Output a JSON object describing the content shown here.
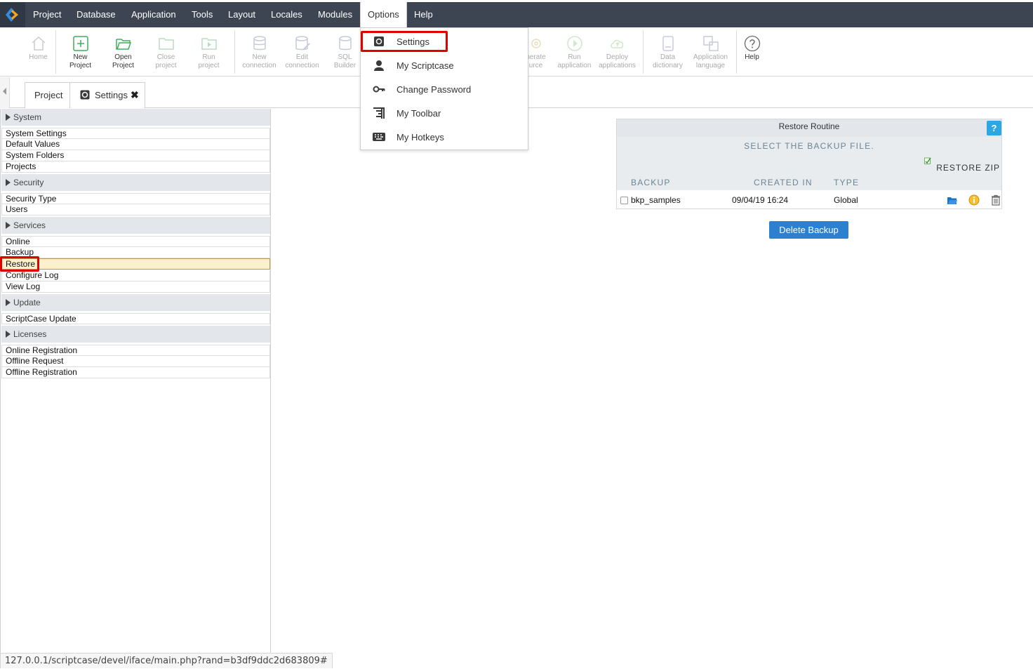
{
  "menubar": {
    "items": [
      "Project",
      "Database",
      "Application",
      "Tools",
      "Layout",
      "Locales",
      "Modules",
      "Options",
      "Help"
    ],
    "active": "Options"
  },
  "toolbar": {
    "buttons": [
      {
        "label1": "Home",
        "label2": "",
        "icon": "home-icon"
      },
      {
        "label1": "New",
        "label2": "Project",
        "icon": "plus-square-icon"
      },
      {
        "label1": "Open",
        "label2": "Project",
        "icon": "folder-open-icon"
      },
      {
        "label1": "Close",
        "label2": "project",
        "icon": "folder-icon"
      },
      {
        "label1": "Run",
        "label2": "project",
        "icon": "play-folder-icon"
      },
      {
        "label1": "New",
        "label2": "connection",
        "icon": "database-icon"
      },
      {
        "label1": "Edit",
        "label2": "connection",
        "icon": "database-edit-icon"
      },
      {
        "label1": "SQL",
        "label2": "Builder",
        "icon": "database-sql-icon"
      },
      {
        "label1": "nerate",
        "label2": "urce",
        "icon": "gear-icon"
      },
      {
        "label1": "Run",
        "label2": "application",
        "icon": "play-circle-icon"
      },
      {
        "label1": "Deploy",
        "label2": "applications",
        "icon": "cloud-upload-icon"
      },
      {
        "label1": "Data",
        "label2": "dictionary",
        "icon": "book-icon"
      },
      {
        "label1": "Application",
        "label2": "language",
        "icon": "translate-icon"
      },
      {
        "label1": "Help",
        "label2": "",
        "icon": "question-icon"
      }
    ]
  },
  "tabs": [
    {
      "label": "Project"
    },
    {
      "label": "Settings"
    }
  ],
  "options_menu": {
    "items": [
      "Settings",
      "My Scriptcase",
      "Change Password",
      "My Toolbar",
      "My Hotkeys"
    ]
  },
  "sidebar": {
    "sections": [
      {
        "title": "System",
        "items": [
          "System Settings",
          "Default Values",
          "System Folders",
          "Projects"
        ]
      },
      {
        "title": "Security",
        "items": [
          "Security Type",
          "Users"
        ]
      },
      {
        "title": "Services",
        "items": [
          "Online",
          "Backup",
          "Restore",
          "Configure Log",
          "View Log"
        ]
      },
      {
        "title": "Update",
        "items": [
          "ScriptCase Update"
        ]
      },
      {
        "title": "Licenses",
        "items": [
          "Online Registration",
          "Offline Request",
          "Offline Registration"
        ]
      }
    ],
    "selected": "Restore"
  },
  "restore": {
    "title": "Restore Routine",
    "help": "?",
    "select_text": "SELECT THE BACKUP FILE.",
    "restore_zip": "RESTORE ZIP",
    "columns": [
      "BACKUP",
      "CREATED IN",
      "TYPE"
    ],
    "rows": [
      {
        "backup": "bkp_samples",
        "created": "09/04/19 16:24",
        "type": "Global"
      }
    ],
    "delete_button": "Delete Backup"
  },
  "status_url": "127.0.0.1/scriptcase/devel/iface/main.php?rand=b3df9ddc2d683809#",
  "colors": {
    "menubar": "#3d4552",
    "accent": "#2d80cf",
    "highlight": "#e00000",
    "selected_row": "#fdf1cd"
  }
}
